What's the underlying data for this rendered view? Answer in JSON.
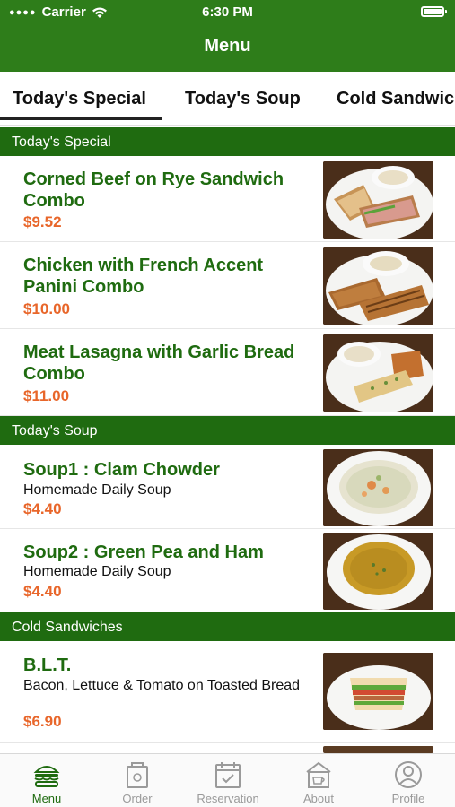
{
  "status_bar": {
    "carrier": "Carrier",
    "time": "6:30 PM"
  },
  "nav": {
    "title": "Menu"
  },
  "tabs": [
    {
      "label": "Today's Special",
      "selected": true
    },
    {
      "label": "Today's Soup",
      "selected": false
    },
    {
      "label": "Cold Sandwic",
      "selected": false
    }
  ],
  "sections": [
    {
      "title": "Today's Special",
      "items": [
        {
          "name": "Corned Beef on Rye Sandwich Combo",
          "price": "$9.52",
          "image": "sandwich-soup-photo"
        },
        {
          "name": "Chicken with French Accent Panini Combo",
          "price": "$10.00",
          "image": "panini-soup-photo"
        },
        {
          "name": "Meat Lasagna with Garlic Bread Combo",
          "price": "$11.00",
          "image": "lasagna-bread-photo"
        }
      ]
    },
    {
      "title": "Today's Soup",
      "items": [
        {
          "name": "Soup1 : Clam Chowder",
          "description": "Homemade Daily Soup",
          "price": "$4.40",
          "image": "clam-chowder-photo"
        },
        {
          "name": "Soup2 : Green Pea and Ham",
          "description": "Homemade Daily Soup",
          "price": "$4.40",
          "image": "pea-soup-photo"
        }
      ]
    },
    {
      "title": "Cold Sandwiches",
      "items": [
        {
          "name": "B.L.T.",
          "description": "Bacon, Lettuce & Tomato on Toasted Bread",
          "price": "$6.90",
          "image": "blt-sandwich-photo"
        }
      ]
    }
  ],
  "tab_bar": [
    {
      "label": "Menu",
      "icon": "burger-icon",
      "active": true
    },
    {
      "label": "Order",
      "icon": "bag-icon",
      "active": false
    },
    {
      "label": "Reservation",
      "icon": "calendar-icon",
      "active": false
    },
    {
      "label": "About",
      "icon": "cafe-icon",
      "active": false
    },
    {
      "label": "Profile",
      "icon": "profile-icon",
      "active": false
    }
  ],
  "colors": {
    "brand_green": "#2e7d1a",
    "section_green": "#1f6b10",
    "price_orange": "#e8662a",
    "inactive_gray": "#9a9a9a"
  }
}
